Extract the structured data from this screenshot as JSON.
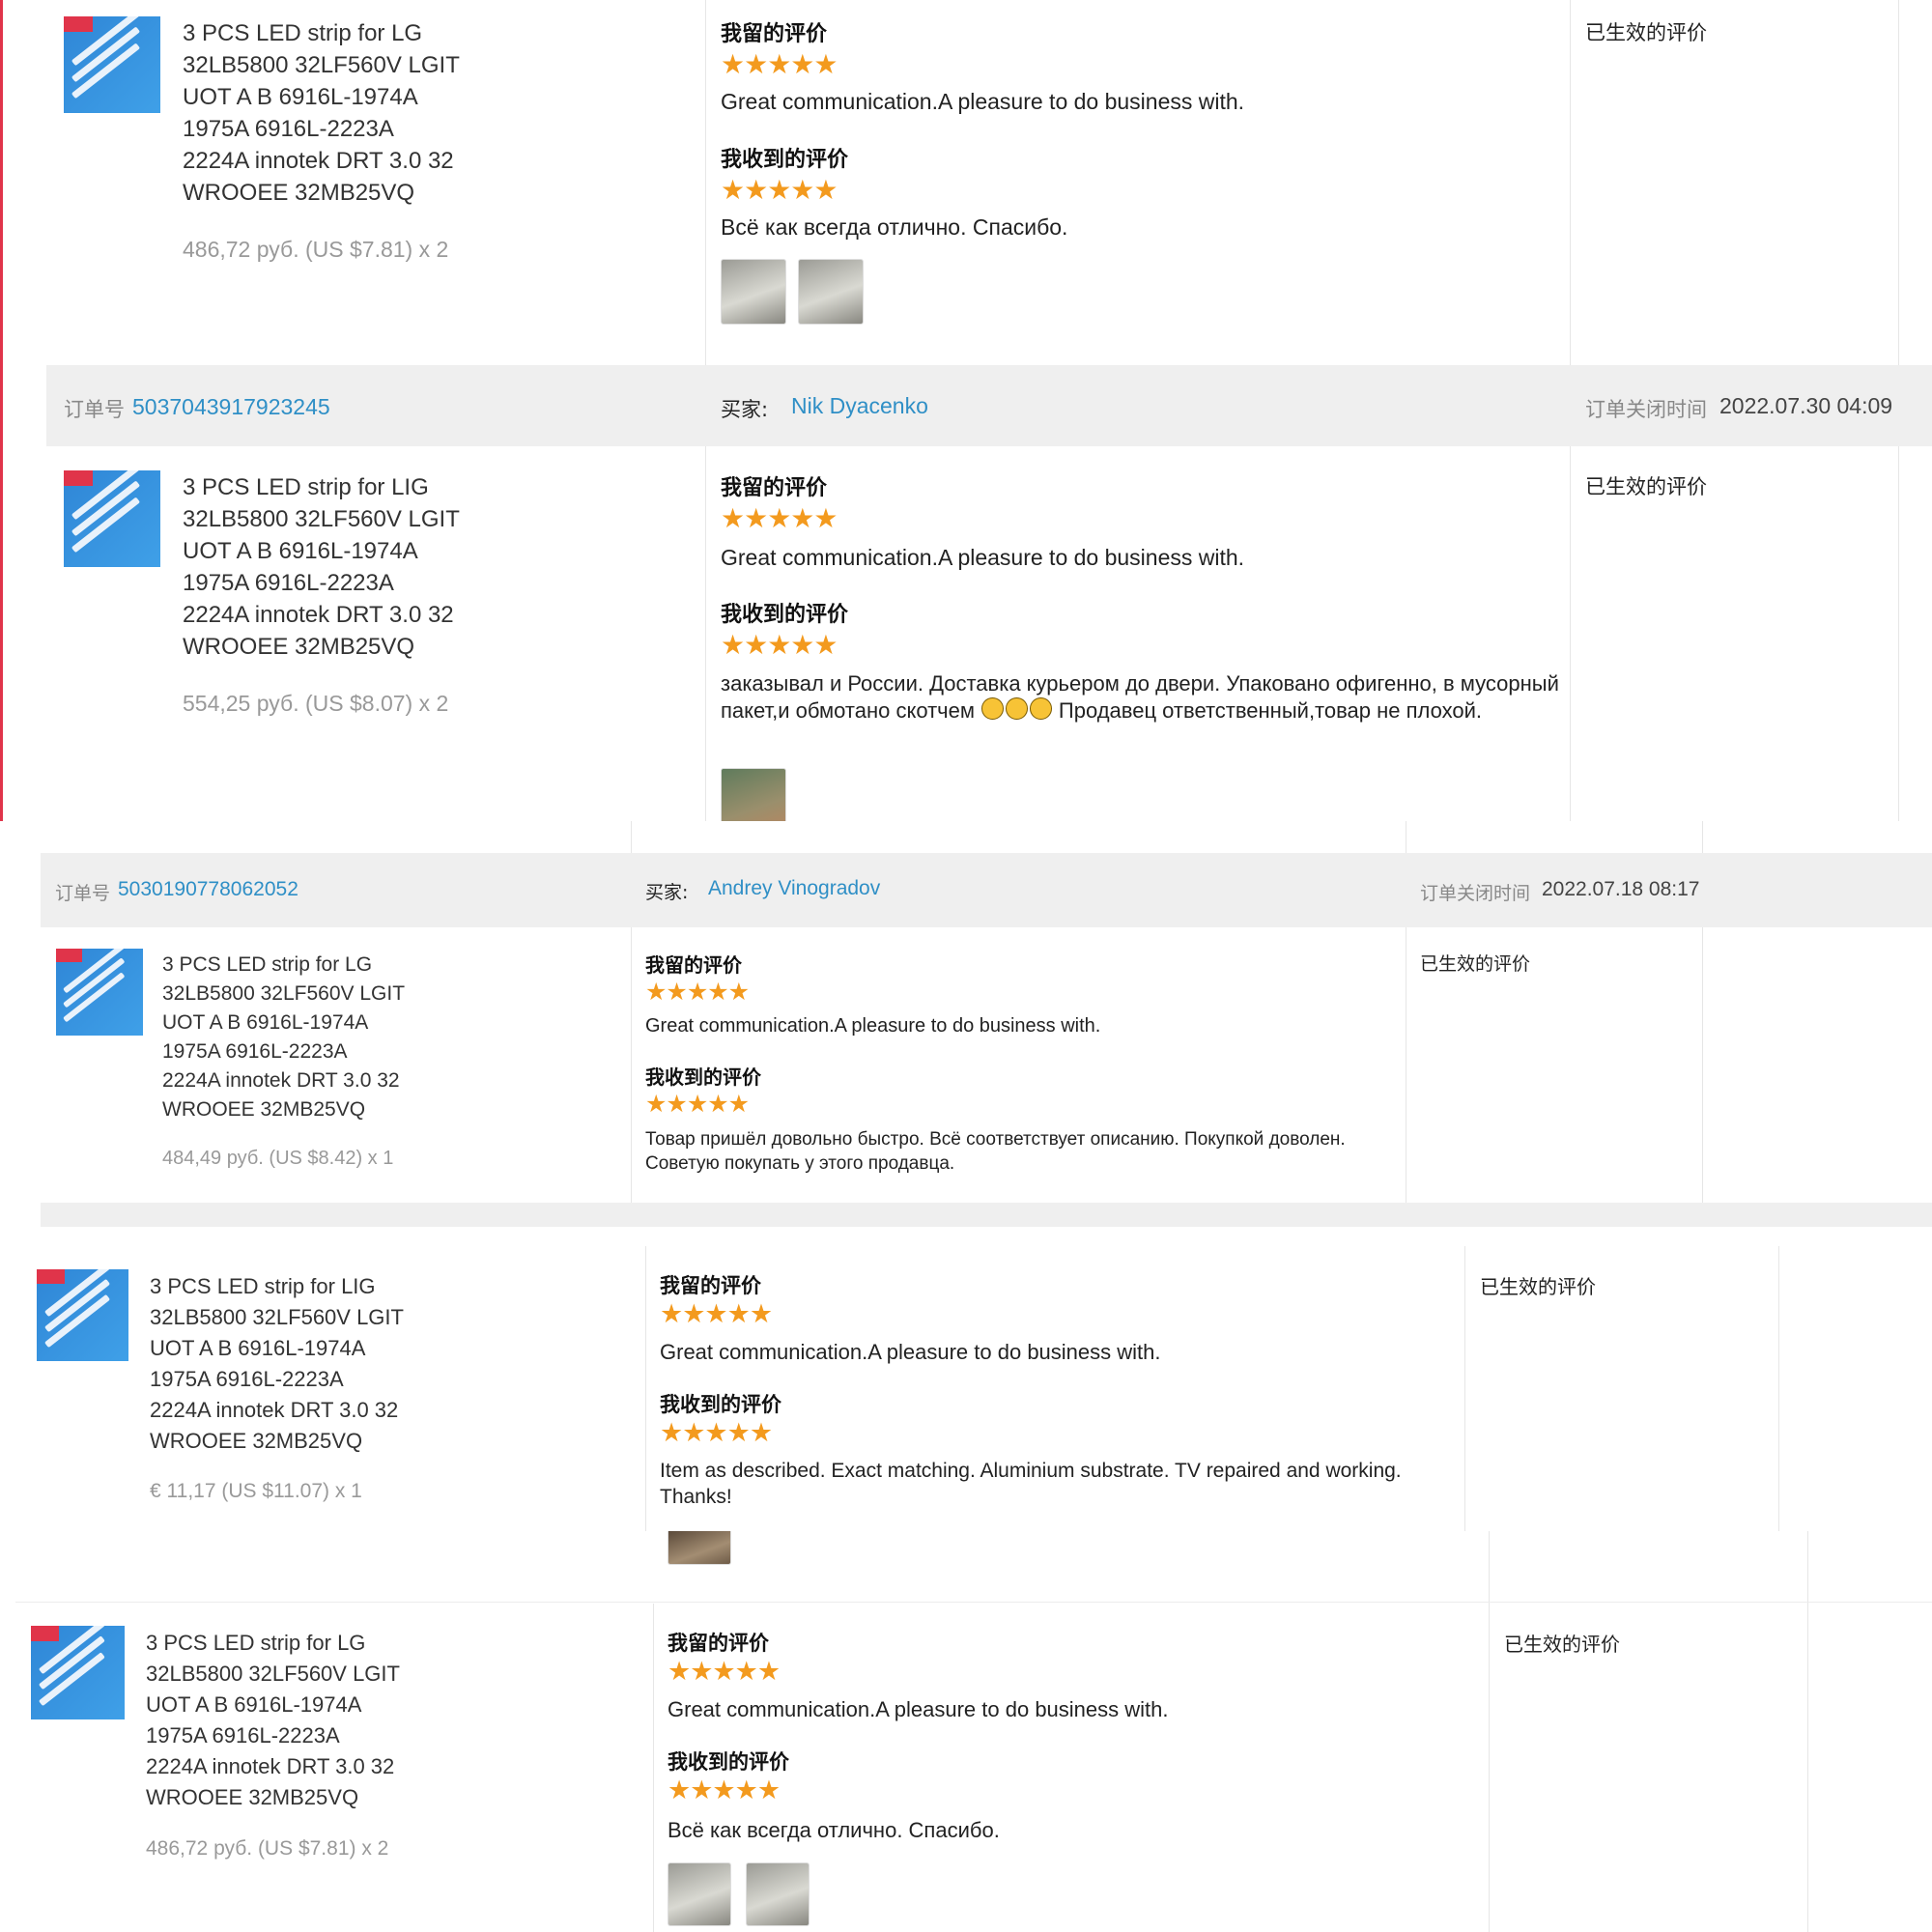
{
  "labels": {
    "my_review": "我留的评价",
    "received_review": "我收到的评价",
    "status": "已生效的评价",
    "order_no": "订单号",
    "buyer": "买家:",
    "closed_time": "订单关闭时间",
    "stars": "★★★★★"
  },
  "colors": {
    "star": "#f39a1e",
    "link": "#2f8fc6",
    "accent": "#e0344a",
    "header_bg": "#efefef"
  },
  "orders": [
    {
      "product_title": "3 PCS LED strip for LG\n32LB5800 32LF560V LGIT\nUOT A B 6916L-1974A\n1975A 6916L-2223A\n2224A innotek DRT 3.0 32\nWROOEE 32MB25VQ",
      "price": "486,72 руб. (US $7.81) x 2",
      "my_rating": 5,
      "my_text": "Great communication.A pleasure to do business with.",
      "received_rating": 5,
      "received_text": "Всё как всегда отлично. Спасибо.",
      "photos": 2
    },
    {
      "order_id": "5037043917923245",
      "buyer": "Nik Dyacenko",
      "closed_time": "2022.07.30 04:09",
      "product_title": "3 PCS LED strip for LIG\n32LB5800 32LF560V LGIT\nUOT A B 6916L-1974A\n1975A 6916L-2223A\n2224A innotek DRT 3.0 32\nWROOEE 32MB25VQ",
      "price": "554,25 руб. (US $8.07) x 2",
      "my_rating": 5,
      "my_text": "Great communication.A pleasure to do business with.",
      "received_rating": 5,
      "received_text_a": "заказывал и России. Доставка курьером до двери. Упаковано офигенно, в мусорный пакет,и обмотано скотчем",
      "received_text_b": "Продавец ответственный,товар не плохой.",
      "photos": 1
    },
    {
      "order_id": "5030190778062052",
      "buyer": "Andrey Vinogradov",
      "closed_time": "2022.07.18 08:17",
      "product_title": "3 PCS LED strip for LG\n32LB5800 32LF560V LGIT\nUOT A B 6916L-1974A\n1975A 6916L-2223A\n2224A innotek DRT 3.0 32\nWROOEE 32MB25VQ",
      "price": "484,49 руб. (US $8.42) x 1",
      "my_rating": 5,
      "my_text": "Great communication.A pleasure to do business with.",
      "received_rating": 5,
      "received_text": "Товар пришёл довольно быстро. Всё соответствует описанию. Покупкой доволен. Советую покупать у этого продавца."
    },
    {
      "product_title": "3 PCS LED strip for LIG\n32LB5800 32LF560V LGIT\nUOT A B 6916L-1974A\n1975A 6916L-2223A\n2224A innotek DRT 3.0 32\nWROOEE 32MB25VQ",
      "price": "€ 11,17 (US $11.07) x 1",
      "my_rating": 5,
      "my_text": "Great communication.A pleasure to do business with.",
      "received_rating": 5,
      "received_text": "Item as described. Exact matching. Aluminium substrate. TV repaired and working. Thanks!",
      "photos": 1
    },
    {
      "product_title": "3 PCS LED strip for LG\n32LB5800 32LF560V LGIT\nUOT A B 6916L-1974A\n1975A 6916L-2223A\n2224A innotek DRT 3.0 32\nWROOEE 32MB25VQ",
      "price": "486,72 руб. (US $7.81) x 2",
      "my_rating": 5,
      "my_text": "Great communication.A pleasure to do business with.",
      "received_rating": 5,
      "received_text": "Всё как всегда отлично. Спасибо.",
      "photos": 2
    }
  ]
}
